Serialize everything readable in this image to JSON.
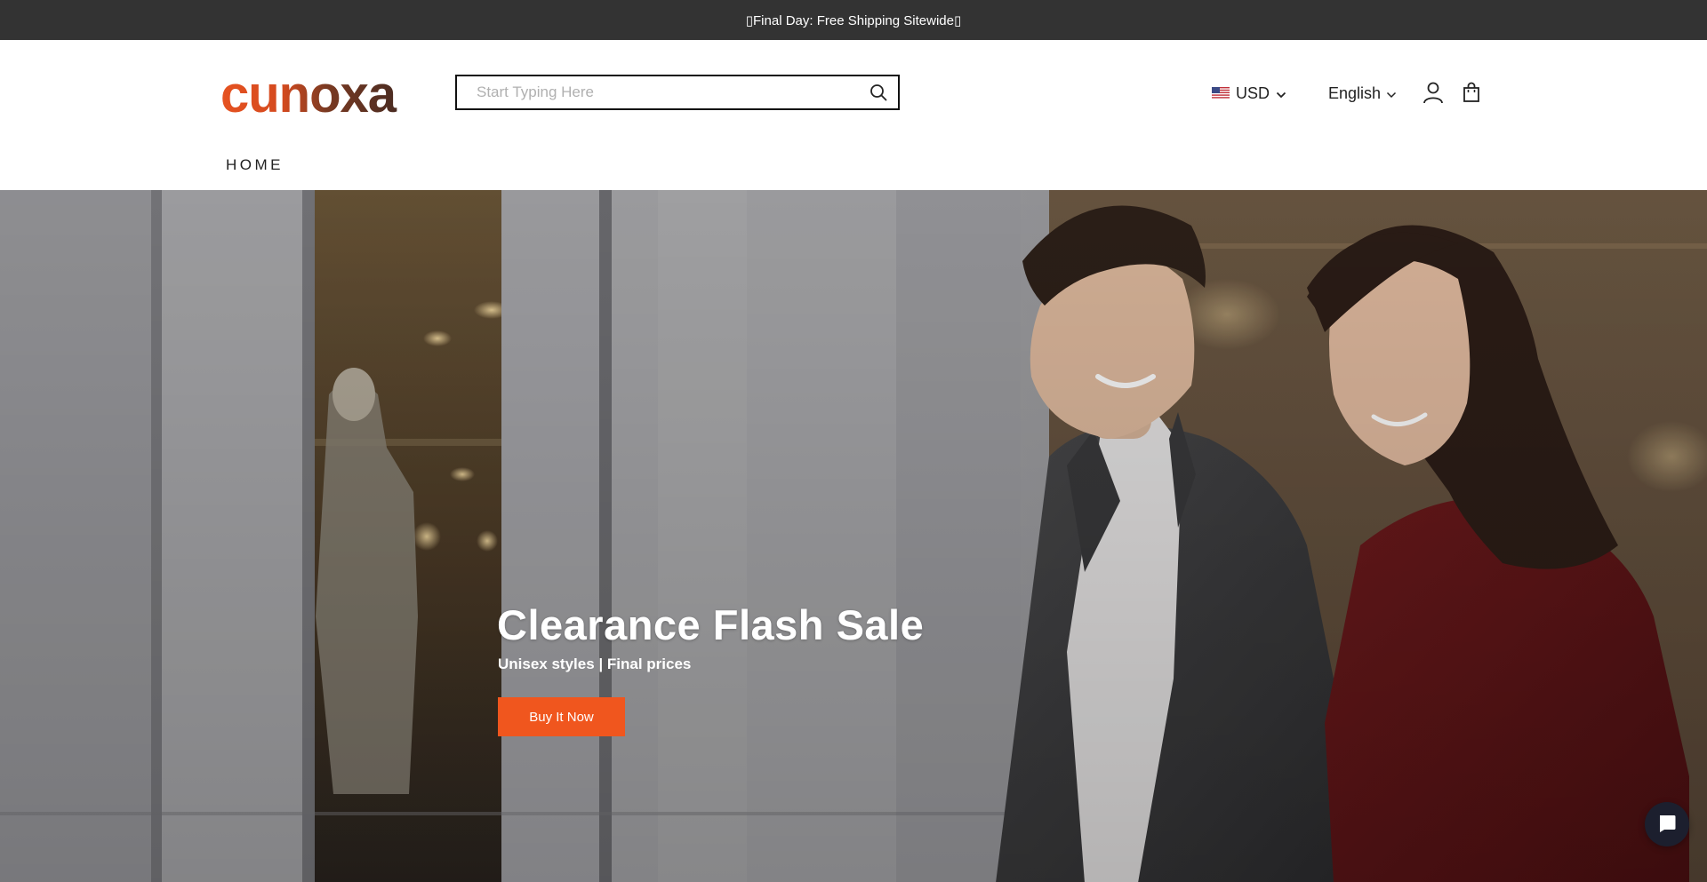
{
  "announcement": {
    "text": "▯Final Day: Free Shipping Sitewide▯"
  },
  "header": {
    "logo_text": "cunoxa",
    "search": {
      "placeholder": "Start Typing Here",
      "value": ""
    },
    "currency": {
      "label": "USD",
      "flag_icon": "us-flag-icon"
    },
    "language": {
      "label": "English"
    },
    "icons": [
      "search-icon",
      "user-icon",
      "shopping-bag-icon",
      "chevron-down-icon"
    ]
  },
  "nav": {
    "items": [
      {
        "label": "HOME"
      }
    ]
  },
  "hero": {
    "title": "Clearance Flash Sale",
    "subtitle": "Unisex styles | Final prices",
    "cta_label": "Buy It Now"
  },
  "chat": {
    "icon": "chat-bubble-icon"
  },
  "colors": {
    "accent": "#f0561e",
    "logo_orange": "#e2501e",
    "logo_brown": "#5a3426",
    "announcement_bg": "#333333"
  }
}
